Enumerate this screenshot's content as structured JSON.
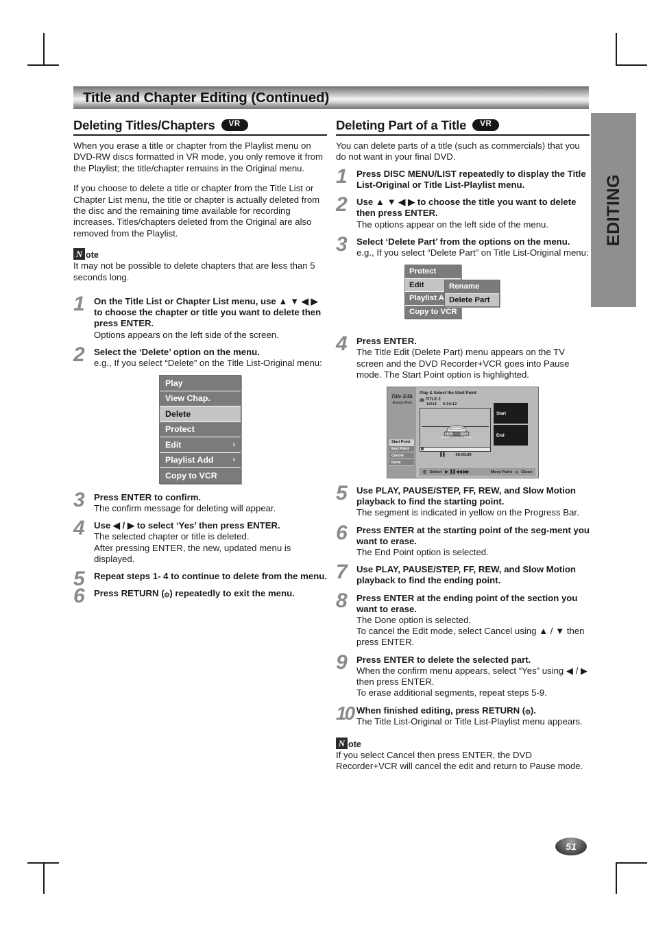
{
  "banner": {
    "title": "Title and Chapter Editing (Continued)"
  },
  "side_tab": {
    "label": "EDITING"
  },
  "page_number": "51",
  "left_column": {
    "heading": "Deleting Titles/Chapters",
    "badge": "VR",
    "intro1": "When you erase a title or chapter from the Playlist menu on DVD-RW discs formatted in VR mode, you only remove it from the Playlist; the title/chapter remains in the Original menu.",
    "intro2": "If you choose to delete a title or chapter from the Title List or Chapter List menu, the title or chapter is actually deleted from the disc and the remaining time available for recording increases. Titles/chapters deleted from the Original are also removed from the Playlist.",
    "note": {
      "n": "N",
      "ote": "ote",
      "text": "It may not be possible to delete chapters that are less than 5 seconds long."
    },
    "steps": [
      {
        "num": "1",
        "lead": "On the Title List or Chapter List menu, use ▲ ▼ ◀ ▶ to choose the chapter or title you want to delete then press ENTER.",
        "sub": "Options appears on the left side of the screen."
      },
      {
        "num": "2",
        "lead": "Select the ‘Delete’ option on the menu.",
        "sub": "e.g., If you select “Delete” on the Title List-Original menu:"
      },
      {
        "num": "3",
        "lead": "Press ENTER to confirm.",
        "sub": "The confirm message for deleting will appear."
      },
      {
        "num": "4",
        "lead": "Use ◀ / ▶ to select ‘Yes’ then press ENTER.",
        "sub": "The selected chapter or title is deleted.",
        "sub2": "After pressing ENTER, the new, updated menu is displayed."
      },
      {
        "num": "5",
        "lead": "Repeat steps 1- 4 to continue to delete from the menu.",
        "sub": ""
      },
      {
        "num": "6",
        "lead": "Press RETURN (۞) repeatedly to exit the menu.",
        "sub": ""
      }
    ],
    "osd_menu": {
      "items": [
        {
          "label": "Play",
          "arrow": "",
          "selected": false
        },
        {
          "label": "View Chap.",
          "arrow": "",
          "selected": false
        },
        {
          "label": "Delete",
          "arrow": "",
          "selected": true
        },
        {
          "label": "Protect",
          "arrow": "",
          "selected": false
        },
        {
          "label": "Edit",
          "arrow": "›",
          "selected": false
        },
        {
          "label": "Playlist Add",
          "arrow": "›",
          "selected": false
        },
        {
          "label": "Copy to VCR",
          "arrow": "",
          "selected": false
        }
      ]
    }
  },
  "right_column": {
    "heading": "Deleting Part of a Title",
    "badge": "VR",
    "intro1": "You can delete parts of a title (such as commercials) that you do not want in your final DVD.",
    "steps": [
      {
        "num": "1",
        "lead": "Press DISC MENU/LIST repeatedly to display the Title List-Original or Title List-Playlist menu.",
        "sub": ""
      },
      {
        "num": "2",
        "lead": "Use ▲ ▼ ◀ ▶ to choose the title you want to delete then press ENTER.",
        "sub": "The options appear on the left side of the menu."
      },
      {
        "num": "3",
        "lead": "Select ‘Delete Part’ from the options on the menu.",
        "sub": "e.g., If you select “Delete Part” on Title List-Original menu:"
      },
      {
        "num": "4",
        "lead": "Press ENTER.",
        "sub": "The Title Edit (Delete Part) menu appears on the TV screen and the DVD Recorder+VCR goes into Pause mode. The Start Point option is highlighted."
      },
      {
        "num": "5",
        "lead": "Use PLAY, PAUSE/STEP, FF, REW, and Slow Motion playback to find the starting point.",
        "sub": "The segment is indicated in yellow on the Progress Bar."
      },
      {
        "num": "6",
        "lead": "Press ENTER at the starting point of the seg-ment you want to erase.",
        "sub": "The End Point option is selected."
      },
      {
        "num": "7",
        "lead": "Use PLAY, PAUSE/STEP, FF, REW, and Slow Motion playback to find the ending point.",
        "sub": ""
      },
      {
        "num": "8",
        "lead": "Press ENTER at the ending point of the section you want to erase.",
        "sub": "The Done option is selected.",
        "sub2": "To cancel the Edit mode, select Cancel using ▲ / ▼ then press ENTER."
      },
      {
        "num": "9",
        "lead": "Press ENTER to delete the selected part.",
        "sub": "When the confirm menu appears, select “Yes” using ◀ / ▶ then press ENTER.",
        "sub2": "To erase additional segments, repeat steps 5-9."
      },
      {
        "num": "10",
        "lead": "When finished editing, press RETURN (۞).",
        "sub": "The Title List-Original or Title List-Playlist menu appears."
      }
    ],
    "osd_menu": {
      "items": [
        {
          "label": "Protect",
          "selected": false
        },
        {
          "label": "Edit",
          "selected": true
        },
        {
          "label": "Playlist Ad",
          "selected": false
        },
        {
          "label": "Copy to VCR",
          "selected": false
        }
      ],
      "submenu": [
        {
          "label": "Rename",
          "selected": false
        },
        {
          "label": "Delete Part",
          "selected": true
        }
      ]
    },
    "tv_screen": {
      "menu_title": "Title Edit",
      "menu_sub": "-Delete Part",
      "heading": "Play & Select the Start Point",
      "title_label": "TITLE 2",
      "meta_left": "10/14",
      "meta_right": "0:34:12",
      "timecode": "00:00:00",
      "pause_icon": "▐▐",
      "options": [
        {
          "label": "Start Point",
          "highlighted": true
        },
        {
          "label": "End Point",
          "highlighted": false
        },
        {
          "label": "Cancel",
          "highlighted": false
        },
        {
          "label": "Done",
          "highlighted": false
        }
      ],
      "thumbs": [
        {
          "label": "Start"
        },
        {
          "label": "End"
        }
      ],
      "footbar": {
        "select": "Select",
        "transport": "▶ ▐▐ ◀◀ ▶▶",
        "move": "Move Point",
        "close": "Close"
      }
    },
    "note": {
      "n": "N",
      "ote": "ote",
      "text": "If you select Cancel then press ENTER, the DVD Recorder+VCR will cancel the edit and return to Pause mode."
    }
  }
}
